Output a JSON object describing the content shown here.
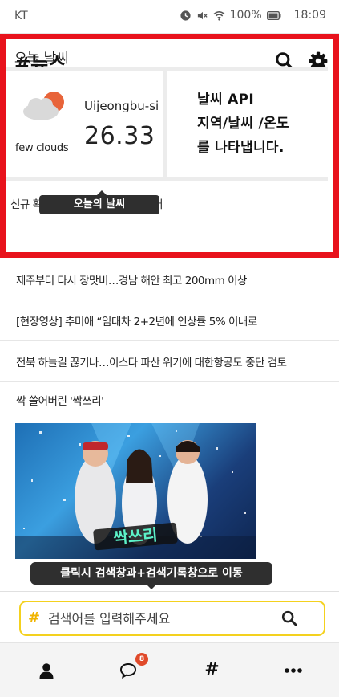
{
  "status_bar": {
    "carrier": "KT",
    "battery": "100%",
    "time": "18:09"
  },
  "header": {
    "title": "#뉴스"
  },
  "weather_section": {
    "label": "오늘 날씨",
    "description": "few clouds",
    "city": "Uijeongbu-si",
    "temperature": "26.33"
  },
  "info_card": {
    "text": "날씨 API\n지역/날씨 /온도\n를 나타냅니다."
  },
  "tooltips": {
    "weather": "오늘의 날씨",
    "search": "클릭시 검색창과+검색기록창으로 이동"
  },
  "news": [
    {
      "title": "신규 확진 2주 만에 20명 대로 줄어"
    },
    {
      "title": "제주부터 다시 장맛비…경남 해안 최고 200mm 이상"
    },
    {
      "title": "[현장영상] 추미애 “임대차 2+2년에 인상률 5% 이내로"
    },
    {
      "title": "전북 하늘길 끊기나…이스타 파산 위기에 대한항공도 중단 검토"
    },
    {
      "title": "싹 쓸어버린 '싹쓰리'"
    }
  ],
  "image": {
    "caption": "싹쓰리"
  },
  "search": {
    "hash": "#",
    "placeholder": "검색어를 입력해주세요"
  },
  "bottom_nav": {
    "chat_badge": "8",
    "hash_label": "#"
  },
  "colors": {
    "highlight_frame": "#e8121c",
    "search_border": "#f4d11e",
    "badge": "#e04a2a"
  }
}
